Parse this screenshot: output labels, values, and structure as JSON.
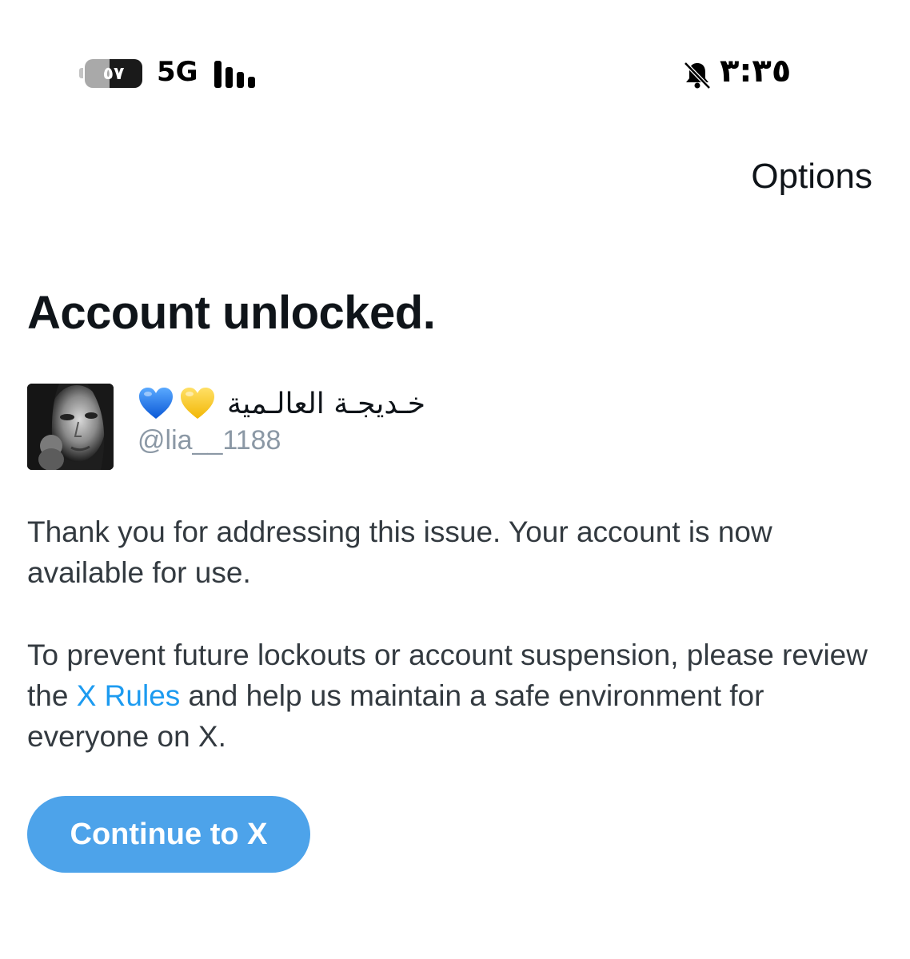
{
  "status_bar": {
    "battery_level": "٥٧",
    "network": "5G",
    "time": "٣:٣٥",
    "silent_icon": "bell-slash-icon"
  },
  "header": {
    "options_label": "Options"
  },
  "main": {
    "title": "Account unlocked.",
    "profile": {
      "display_name": "خـديجـة العالـمية",
      "handle": "@lia__1188",
      "emojis": [
        "blue-heart-icon",
        "yellow-heart-icon"
      ]
    },
    "paragraph1": "Thank you for addressing this issue. Your account is now available for use.",
    "paragraph2": {
      "before": "To prevent future lockouts or account suspension, please review the ",
      "link": "X Rules",
      "after": " and help us maintain a safe environment for everyone on X."
    },
    "continue_label": "Continue to X"
  },
  "colors": {
    "accent": "#1d9bf0",
    "button": "#4da3ea",
    "text": "#0f1419",
    "muted": "#8b98a5"
  }
}
